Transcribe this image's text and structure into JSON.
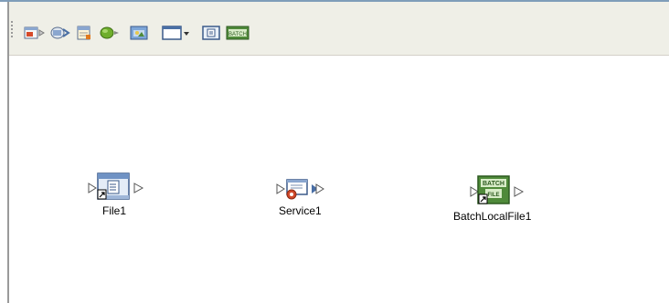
{
  "toolbar": {
    "buttons": [
      {
        "name": "file-adapter-icon",
        "tooltip": ""
      },
      {
        "name": "service-adapter-icon",
        "tooltip": ""
      },
      {
        "name": "calendar-icon",
        "tooltip": ""
      },
      {
        "name": "connection-icon",
        "tooltip": ""
      },
      {
        "name": "image-icon",
        "tooltip": ""
      },
      {
        "name": "window-dropdown-icon",
        "tooltip": ""
      },
      {
        "name": "document-icon",
        "tooltip": ""
      },
      {
        "name": "batch-icon",
        "label": "BATCH"
      }
    ]
  },
  "canvas": {
    "nodes": [
      {
        "label": "File1",
        "icon": "file-icon"
      },
      {
        "label": "Service1",
        "icon": "service-icon"
      },
      {
        "label": "BatchLocalFile1",
        "icon": "batch-file-icon",
        "badge_top": "BATCH",
        "badge_bottom": "FILE"
      }
    ]
  }
}
